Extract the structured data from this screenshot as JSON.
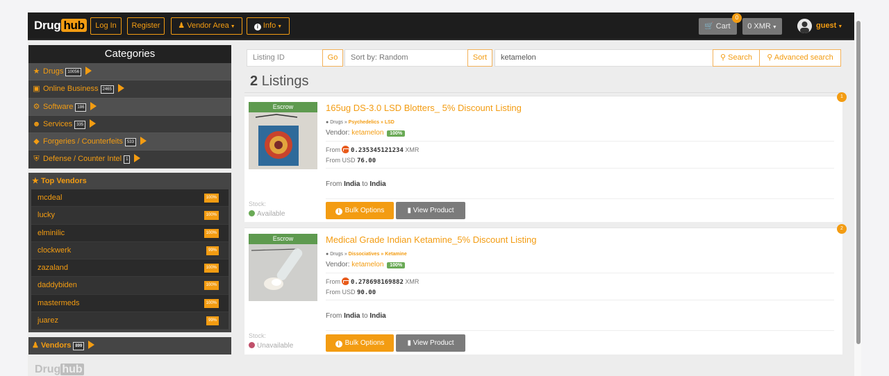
{
  "brand": {
    "name_left": "Drug",
    "name_right": "hub"
  },
  "nav": {
    "login": "Log In",
    "register": "Register",
    "vendor_area": "Vendor Area",
    "info": "Info",
    "cart_label": "Cart",
    "cart_count": "0",
    "currency": "0 XMR",
    "user": "guest"
  },
  "categories": {
    "title": "Categories",
    "items": [
      {
        "label": "Drugs",
        "count": "10056",
        "icon": "pills-icon"
      },
      {
        "label": "Online Business",
        "count": "2465",
        "icon": "briefcase-icon"
      },
      {
        "label": "Software",
        "count": "186",
        "icon": "gear-icon"
      },
      {
        "label": "Services",
        "count": "335",
        "icon": "person-icon"
      },
      {
        "label": "Forgeries / Counterfeits",
        "count": "533",
        "icon": "gem-icon"
      },
      {
        "label": "Defense / Counter Intel",
        "count": "1",
        "icon": "shield-icon"
      }
    ]
  },
  "top_vendors": {
    "title": "Top Vendors",
    "items": [
      {
        "name": "mcdeal",
        "pct": "100%"
      },
      {
        "name": "lucky",
        "pct": "100%"
      },
      {
        "name": "elminilic",
        "pct": "100%"
      },
      {
        "name": "clockwerk",
        "pct": "99%"
      },
      {
        "name": "zazaland",
        "pct": "100%"
      },
      {
        "name": "daddybiden",
        "pct": "100%"
      },
      {
        "name": "mastermeds",
        "pct": "100%"
      },
      {
        "name": "juarez",
        "pct": "99%"
      }
    ]
  },
  "vendors_bar": {
    "label": "Vendors",
    "count": "899"
  },
  "search": {
    "listing_id_placeholder": "Listing ID",
    "go": "Go",
    "sort_by": "Sort by: Random",
    "sort": "Sort",
    "query": "ketamelon",
    "search_btn": "Search",
    "advanced_btn": "Advanced search"
  },
  "listings_header": {
    "count": "2",
    "label": "Listings"
  },
  "listings": [
    {
      "num": "1",
      "escrow": "Escrow",
      "title": "165ug DS-3.0 LSD Blotters_ 5% Discount Listing",
      "crumb_root": "Drugs",
      "crumb_path": "Psychedelics » LSD",
      "vendor_label": "Vendor:",
      "vendor": "ketamelon",
      "vendor_pct": "100%",
      "xmr_prefix": "From",
      "xmr_price": "0.235345121234",
      "xmr_unit": "XMR",
      "usd_prefix": "From USD",
      "usd_price": "76.00",
      "ship_from_word": "From",
      "ship_from": "India",
      "ship_to_word": "to",
      "ship_to": "India",
      "stock_label": "Stock:",
      "stock": "Available",
      "stock_color": "#6aaa56",
      "bulk": "Bulk Options",
      "view": "View Product"
    },
    {
      "num": "2",
      "escrow": "Escrow",
      "title": "Medical Grade Indian Ketamine_5% Discount Listing",
      "crumb_root": "Drugs",
      "crumb_path": "Dissociatives » Ketamine",
      "vendor_label": "Vendor:",
      "vendor": "ketamelon",
      "vendor_pct": "100%",
      "xmr_prefix": "From",
      "xmr_price": "0.278698169882",
      "xmr_unit": "XMR",
      "usd_prefix": "From USD",
      "usd_price": "90.00",
      "ship_from_word": "From",
      "ship_from": "India",
      "ship_to_word": "to",
      "ship_to": "India",
      "stock_label": "Stock:",
      "stock": "Unavailable",
      "stock_color": "#c0506a",
      "bulk": "Bulk Options",
      "view": "View Product"
    }
  ]
}
